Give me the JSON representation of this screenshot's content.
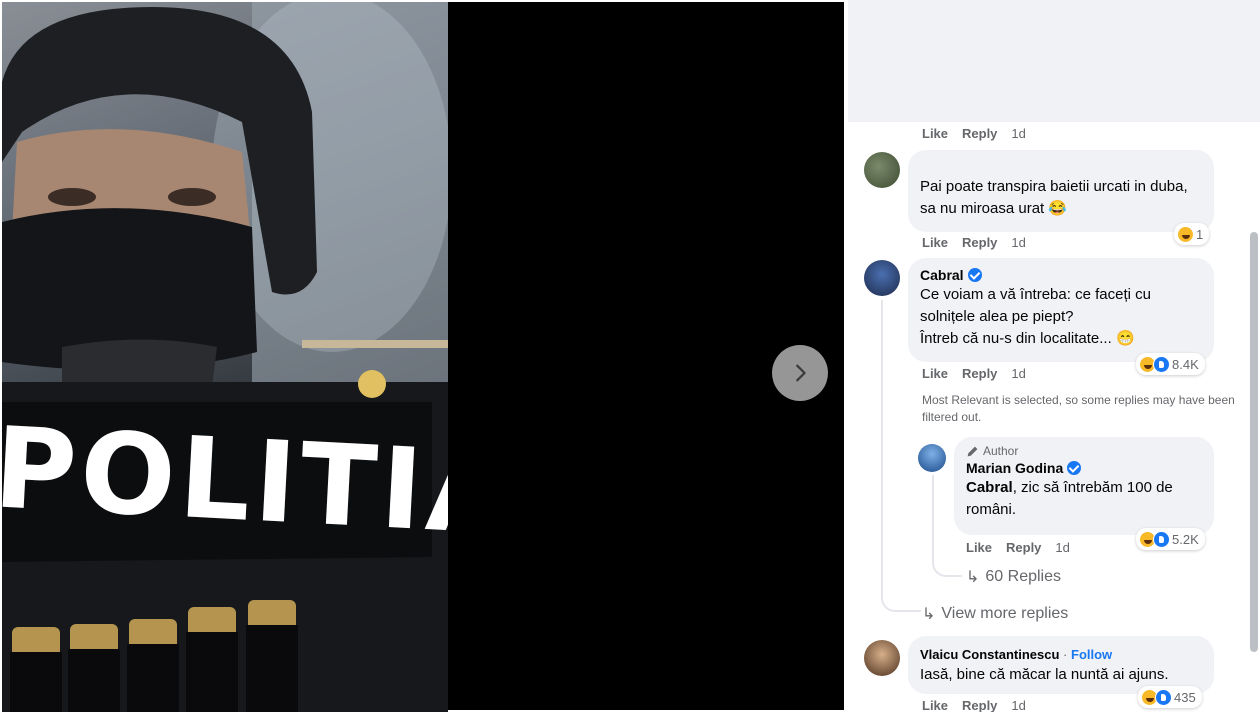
{
  "viewer": {
    "photo_text": "POLITIA",
    "next_icon": "chevron-right-icon"
  },
  "comments": {
    "top_actions": {
      "like": "Like",
      "reply": "Reply",
      "time": "1d"
    },
    "c1": {
      "text": "Pai poate transpira baietii urcati in duba, sa nu miroasa urat 😂",
      "reaction_count": "1",
      "like": "Like",
      "reply": "Reply",
      "time": "1d"
    },
    "c2": {
      "author": "Cabral",
      "text": "Ce voiam a vă întreba: ce faceți cu solnițele alea pe piept?\nÎntreb că nu-s din localitate... 😁",
      "reaction_count": "8.4K",
      "like": "Like",
      "reply": "Reply",
      "time": "1d"
    },
    "relevance_note": "Most Relevant is selected, so some replies may have been filtered out.",
    "reply1": {
      "badge": "Author",
      "author": "Marian Godina",
      "mention": "Cabral",
      "text": ", zic să întrebăm 100 de români.",
      "reaction_count": "5.2K",
      "like": "Like",
      "reply": "Reply",
      "time": "1d"
    },
    "replies_link": "60 Replies",
    "view_more": "View more replies",
    "c3": {
      "author": "Vlaicu Constantinescu",
      "follow": "Follow",
      "text": "Iasă, bine că măcar la nuntă ai ajuns.",
      "reaction_count": "435",
      "like": "Like",
      "reply": "Reply",
      "time": "1d"
    }
  },
  "colors": {
    "accent": "#1877f2",
    "bubble": "#f0f2f5",
    "meta": "#65676b"
  }
}
